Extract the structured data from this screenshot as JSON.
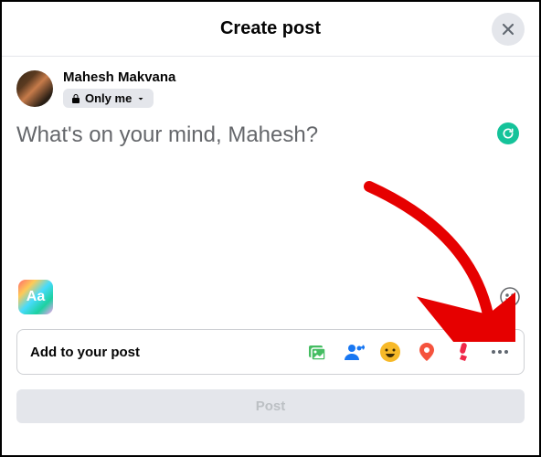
{
  "header": {
    "title": "Create post"
  },
  "user": {
    "name": "Mahesh Makvana",
    "privacy": "Only me"
  },
  "compose": {
    "placeholder": "What's on your mind, Mahesh?"
  },
  "bg": {
    "aa": "Aa"
  },
  "addbar": {
    "label": "Add to your post"
  },
  "post": {
    "label": "Post"
  }
}
